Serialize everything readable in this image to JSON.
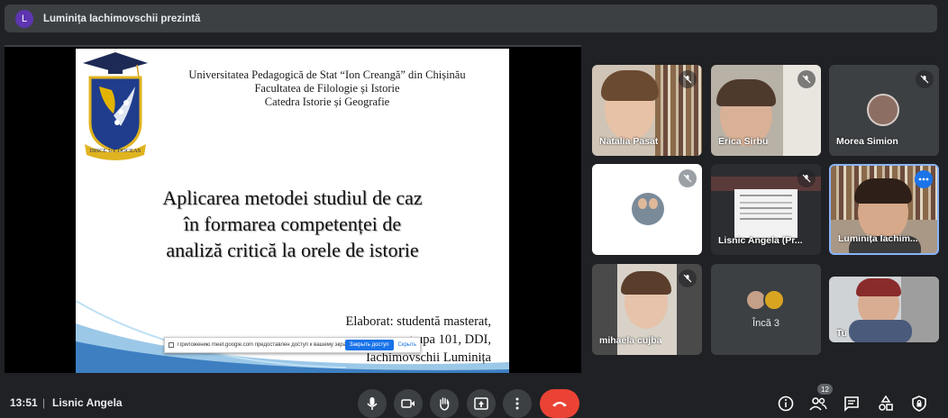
{
  "topbar": {
    "avatar_letter": "L",
    "presenting": "Luminița Iachimovschii prezintă"
  },
  "slide": {
    "crest_motto": "DISCE UT DOCEAS",
    "header_lines": [
      "Universitatea Pedagogică de Stat “Ion Creangă” din Chișinău",
      "Facultatea de Filologie și Istorie",
      "Catedra Istorie și Geografie"
    ],
    "title_lines": [
      "Aplicarea metodei studiul de caz",
      "în formarea competenței de",
      "analiză critică la orele de istorie"
    ],
    "author_lines": [
      "Elaborat: studentă masterat,",
      "grupa 101, DDI,",
      "Iachimovschii Luminița"
    ]
  },
  "share_bar": {
    "message": "Приложению meet.google.com предоставлен доступ к вашему экрану.",
    "stop_label": "Закрыть доступ",
    "hide_label": "Скрыть"
  },
  "participants": [
    {
      "name": "Natalia Pasat",
      "muted": true
    },
    {
      "name": "Erica Sirbu",
      "muted": true
    },
    {
      "name": "Morea Simion",
      "muted": true
    },
    {
      "name": "",
      "muted": true
    },
    {
      "name": "Lisnic Angela (Pr...",
      "muted": true
    },
    {
      "name": "Luminița Iachim...",
      "muted": false
    },
    {
      "name": "mihaela cujba",
      "muted": true
    },
    {
      "name": "Încă 3",
      "muted": false
    },
    {
      "name": "Tu",
      "muted": false
    }
  ],
  "bottombar": {
    "time": "13:51",
    "separator": "|",
    "meeting_name": "Lisnic Angela",
    "people_count": "12"
  },
  "colors": {
    "end_call": "#ea4335",
    "active_tile_border": "#8ab4f8",
    "more_button": "#1a73e8"
  }
}
